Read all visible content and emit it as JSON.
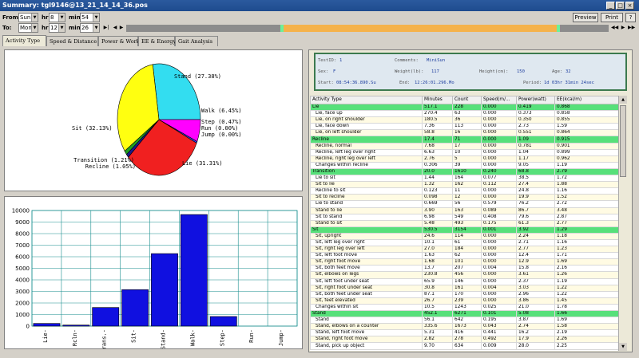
{
  "window": {
    "title": "Summary: tgl9146@13_21_14_14_36.pos"
  },
  "from": {
    "label": "From:",
    "day": "Sun",
    "hr_label": "hr",
    "hr": "8",
    "min_label": "min.",
    "min": "54"
  },
  "to": {
    "label": "To:",
    "day": "Mon",
    "hr_label": "hr",
    "hr": "12",
    "min_label": "min.",
    "min": "26"
  },
  "buttons": {
    "preview": "Preview",
    "print": "Print",
    "help": "?"
  },
  "tabs": [
    "Activity Type",
    "Speed & Distance",
    "Power & Work",
    "EE & Energy",
    "Gait Analysis"
  ],
  "summary": {
    "testid_label": "TestID:",
    "testid": "1",
    "comments_label": "Comments:",
    "comments": "MiniSun",
    "sex_label": "Sex:",
    "sex": "F",
    "weight_label": "Weight(lb):",
    "weight": "117",
    "height_label": "Height(cm):",
    "height": "150",
    "age_label": "Age:",
    "age": "32",
    "start_label": "Start:",
    "start": "08:54:36.890.Su",
    "end_label": "End:",
    "end": "12:26:01.296.Mo",
    "period_label": "Period:",
    "period": "1d 03hr 31min 24sec"
  },
  "table": {
    "headers": [
      "Activity Type",
      "Minutes",
      "Count",
      "Speed(m/...",
      "Power(watt)",
      "EE(kcal/m)"
    ],
    "rows": [
      {
        "cat": true,
        "c": [
          "Lie",
          "517.1",
          "228",
          "0.000",
          "0.419",
          "0.868"
        ]
      },
      {
        "cat": false,
        "c": [
          "Lie, face up",
          "270.4",
          "63",
          "0.000",
          "0.373",
          "0.858"
        ]
      },
      {
        "cat": false,
        "c": [
          "Lie, on right shoulder",
          "180.5",
          "36",
          "0.000",
          "0.350",
          "0.855"
        ]
      },
      {
        "cat": false,
        "c": [
          "Lie, face down",
          "7.36",
          "113",
          "0.000",
          "2.73",
          "1.59"
        ]
      },
      {
        "cat": false,
        "c": [
          "Lie, on left shoulder",
          "58.8",
          "16",
          "0.000",
          "0.551",
          "0.864"
        ]
      },
      {
        "cat": true,
        "c": [
          "Recline",
          "17.4",
          "71",
          "0.000",
          "1.09",
          "0.915"
        ]
      },
      {
        "cat": false,
        "c": [
          "Recline, normal",
          "7.68",
          "17",
          "0.000",
          "0.781",
          "0.901"
        ]
      },
      {
        "cat": false,
        "c": [
          "Recline, left leg over right",
          "6.63",
          "10",
          "0.000",
          "1.04",
          "0.899"
        ]
      },
      {
        "cat": false,
        "c": [
          "Recline, right leg over left",
          "2.76",
          "5",
          "0.000",
          "1.17",
          "0.962"
        ]
      },
      {
        "cat": false,
        "c": [
          "Changes within recline",
          "0.306",
          "39",
          "0.000",
          "9.05",
          "1.19"
        ]
      },
      {
        "cat": true,
        "c": [
          "Transition",
          "20.0",
          "1610",
          "0.240",
          "68.8",
          "2.79"
        ]
      },
      {
        "cat": false,
        "c": [
          "Lie to sit",
          "1.44",
          "164",
          "0.077",
          "38.5",
          "1.72"
        ]
      },
      {
        "cat": false,
        "c": [
          "Sit to lie",
          "1.32",
          "162",
          "0.112",
          "27.4",
          "1.88"
        ]
      },
      {
        "cat": false,
        "c": [
          "Recline to sit",
          "0.123",
          "11",
          "0.000",
          "24.8",
          "1.16"
        ]
      },
      {
        "cat": false,
        "c": [
          "Sit to recline",
          "0.098",
          "12",
          "0.000",
          "19.9",
          "1.52"
        ]
      },
      {
        "cat": false,
        "c": [
          "Lie to stand",
          "0.669",
          "56",
          "0.579",
          "76.2",
          "2.72"
        ]
      },
      {
        "cat": false,
        "c": [
          "Stand to lie",
          "3.90",
          "163",
          "0.089",
          "86.7",
          "3.48"
        ]
      },
      {
        "cat": false,
        "c": [
          "Sit to stand",
          "6.98",
          "549",
          "0.408",
          "79.6",
          "2.87"
        ]
      },
      {
        "cat": false,
        "c": [
          "Stand to sit",
          "5.48",
          "493",
          "0.175",
          "61.3",
          "2.77"
        ]
      },
      {
        "cat": true,
        "c": [
          "Sit",
          "530.5",
          "3154",
          "0.001",
          "3.92",
          "1.29"
        ]
      },
      {
        "cat": false,
        "c": [
          "Sit, upright",
          "24.6",
          "114",
          "0.000",
          "2.24",
          "1.18"
        ]
      },
      {
        "cat": false,
        "c": [
          "Sit, left leg over right",
          "10.1",
          "61",
          "0.000",
          "2.71",
          "1.16"
        ]
      },
      {
        "cat": false,
        "c": [
          "Sit, right leg over left",
          "27.0",
          "184",
          "0.000",
          "2.77",
          "1.23"
        ]
      },
      {
        "cat": false,
        "c": [
          "Sit, left foot move",
          "1.63",
          "62",
          "0.000",
          "12.4",
          "1.71"
        ]
      },
      {
        "cat": false,
        "c": [
          "Sit, right foot move",
          "1.68",
          "101",
          "0.000",
          "12.9",
          "1.69"
        ]
      },
      {
        "cat": false,
        "c": [
          "Sit, both feet move",
          "13.7",
          "207",
          "0.004",
          "15.8",
          "2.16"
        ]
      },
      {
        "cat": false,
        "c": [
          "Sit, elbows on legs",
          "230.8",
          "456",
          "0.000",
          "3.61",
          "1.26"
        ]
      },
      {
        "cat": false,
        "c": [
          "Sit, left foot under seat",
          "65.9",
          "146",
          "0.000",
          "2.37",
          "1.19"
        ]
      },
      {
        "cat": false,
        "c": [
          "Sit, right foot under seat",
          "30.8",
          "161",
          "0.004",
          "3.03",
          "1.22"
        ]
      },
      {
        "cat": false,
        "c": [
          "Sit, both feet under seat",
          "87.1",
          "170",
          "0.000",
          "2.96",
          "1.22"
        ]
      },
      {
        "cat": false,
        "c": [
          "Sit, feet elevated",
          "26.7",
          "239",
          "0.000",
          "3.86",
          "1.45"
        ]
      },
      {
        "cat": false,
        "c": [
          "Changes within sit",
          "10.5",
          "1243",
          "0.025",
          "21.0",
          "1.78"
        ]
      },
      {
        "cat": true,
        "c": [
          "Stand",
          "452.1",
          "6271",
          "0.101",
          "5.08",
          "1.66"
        ]
      },
      {
        "cat": false,
        "c": [
          "Stand",
          "56.1",
          "642",
          "0.195",
          "3.87",
          "1.69"
        ]
      },
      {
        "cat": false,
        "c": [
          "Stand, elbows on a counter",
          "335.6",
          "1673",
          "0.043",
          "2.74",
          "1.58"
        ]
      },
      {
        "cat": false,
        "c": [
          "Stand, left foot move",
          "5.31",
          "416",
          "0.441",
          "16.2",
          "2.19"
        ]
      },
      {
        "cat": false,
        "c": [
          "Stand, right foot move",
          "2.82",
          "278",
          "0.492",
          "17.9",
          "2.26"
        ]
      },
      {
        "cat": false,
        "c": [
          "Stand, pick up object",
          "9.70",
          "634",
          "0.009",
          "28.0",
          "2.25"
        ]
      }
    ]
  },
  "chart_data": [
    {
      "type": "pie",
      "slices": [
        {
          "label": "Stand (27.38%)",
          "value": 27.38,
          "color": "#33ddf0"
        },
        {
          "label": "Walk (6.45%)",
          "value": 6.45,
          "color": "#ff00ff"
        },
        {
          "label": "Step (0.47%)",
          "value": 0.47,
          "color": "#4040ff"
        },
        {
          "label": "Run (0.00%)",
          "value": 0.0,
          "color": "#000000"
        },
        {
          "label": "Jump (0.00%)",
          "value": 0.0,
          "color": "#000000"
        },
        {
          "label": "Lie (31.31%)",
          "value": 31.31,
          "color": "#f02020"
        },
        {
          "label": "Recline (1.05%)",
          "value": 1.05,
          "color": "#1a1a8c"
        },
        {
          "label": "Transition (1.21%)",
          "value": 1.21,
          "color": "#20a020"
        },
        {
          "label": "Sit (32.13%)",
          "value": 32.13,
          "color": "#ffff10"
        }
      ]
    },
    {
      "type": "bar",
      "categories": [
        "Lie",
        "Rcln",
        "Trans.",
        "Sit",
        "Stand",
        "Walk",
        "Step",
        "Run",
        "Jump"
      ],
      "values": [
        230,
        90,
        1610,
        3154,
        6271,
        9650,
        830,
        0,
        0
      ],
      "ylim": [
        0,
        10000
      ],
      "yticks": [
        "0",
        "1000",
        "2000",
        "3000",
        "4000",
        "5000",
        "6000",
        "7000",
        "8000",
        "9000",
        "10000"
      ],
      "color": "#1010e0"
    }
  ]
}
